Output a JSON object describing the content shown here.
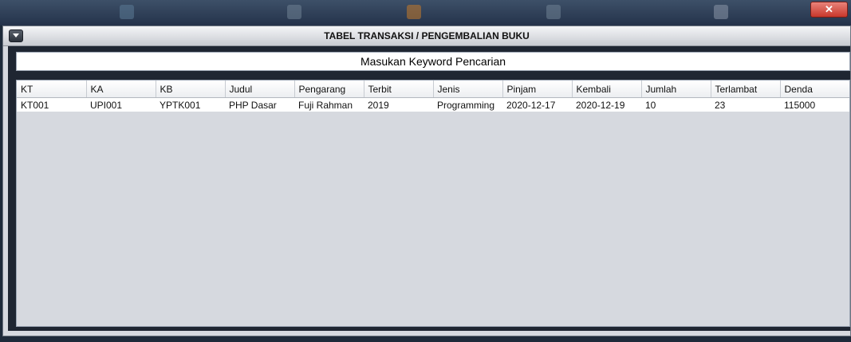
{
  "window": {
    "title": "TABEL TRANSAKSI / PENGEMBALIAN BUKU",
    "close_glyph": "✕"
  },
  "search": {
    "value": "Masukan Keyword Pencarian"
  },
  "table": {
    "columns": [
      "KT",
      "KA",
      "KB",
      "Judul",
      "Pengarang",
      "Terbit",
      "Jenis",
      "Pinjam",
      "Kembali",
      "Jumlah",
      "Terlambat",
      "Denda"
    ],
    "rows": [
      [
        "KT001",
        "UPI001",
        "YPTK001",
        "PHP Dasar",
        "Fuji Rahman",
        "2019",
        "Programming",
        "2020-12-17",
        "2020-12-19",
        "10",
        "23",
        "115000"
      ]
    ]
  },
  "colors": {
    "background": "#1e2a3a",
    "frame": "#d6d9df",
    "content_dark": "#1f2632",
    "header": "#eceef1",
    "close_button": "#c8382c"
  }
}
